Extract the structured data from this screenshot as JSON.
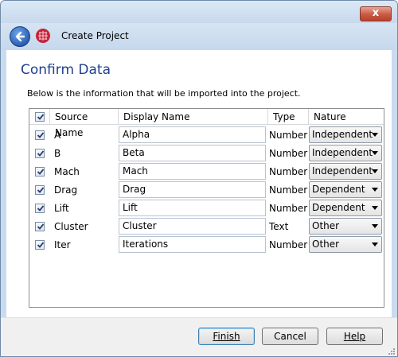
{
  "window": {
    "close_label": "x"
  },
  "header": {
    "title": "Create Project"
  },
  "page": {
    "title": "Confirm Data",
    "instruction": "Below is the information that will be imported into the project."
  },
  "table": {
    "headers": {
      "source": "Source Name",
      "display": "Display Name",
      "type": "Type",
      "nature": "Nature"
    },
    "select_all_checked": true,
    "rows": [
      {
        "checked": true,
        "source": "A",
        "display": "Alpha",
        "type": "Number",
        "nature": "Independent"
      },
      {
        "checked": true,
        "source": "B",
        "display": "Beta",
        "type": "Number",
        "nature": "Independent"
      },
      {
        "checked": true,
        "source": "Mach",
        "display": "Mach",
        "type": "Number",
        "nature": "Independent"
      },
      {
        "checked": true,
        "source": "Drag",
        "display": "Drag",
        "type": "Number",
        "nature": "Dependent"
      },
      {
        "checked": true,
        "source": "Lift",
        "display": "Lift",
        "type": "Number",
        "nature": "Dependent"
      },
      {
        "checked": true,
        "source": "Cluster",
        "display": "Cluster",
        "type": "Text",
        "nature": "Other"
      },
      {
        "checked": true,
        "source": "Iter",
        "display": "Iterations",
        "type": "Number",
        "nature": "Other"
      }
    ]
  },
  "buttons": {
    "finish": "Finish",
    "cancel": "Cancel",
    "help": "Help"
  },
  "colors": {
    "title_blue": "#1f3f8f",
    "chrome": "#c9dbee",
    "close_red": "#c85a43"
  },
  "icons": {
    "back": "back-arrow-icon",
    "app": "app-logo-icon",
    "check": "checkmark-icon",
    "dropdown": "chevron-down-icon"
  }
}
